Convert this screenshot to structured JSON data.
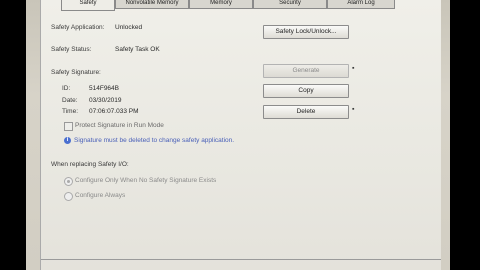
{
  "tabs": [
    "Safety",
    "Nonvolatile Memory",
    "Memory",
    "Security",
    "Alarm Log"
  ],
  "safety_application": {
    "label": "Safety Application:",
    "value": "Unlocked"
  },
  "safety_status": {
    "label": "Safety Status:",
    "value": "Safety Task OK"
  },
  "safety_signature": {
    "label": "Safety Signature:"
  },
  "signature": {
    "id_label": "ID:",
    "id_value": "514F964B",
    "date_label": "Date:",
    "date_value": "03/30/2019",
    "time_label": "Time:",
    "time_value": "07:06:07.033 PM"
  },
  "buttons": {
    "lock": "Safety Lock/Unlock...",
    "generate": "Generate",
    "copy": "Copy",
    "delete": "Delete"
  },
  "protect_checkbox": {
    "label": "Protect Signature in Run Mode",
    "checked": false
  },
  "info_message": "Signature must be deleted to change safety application.",
  "replacing": {
    "label": "When replacing Safety I/O:",
    "options": [
      "Configure Only When No Safety Signature Exists",
      "Configure Always"
    ]
  },
  "colors": {
    "info_text": "#4a60b8",
    "disabled_text": "#8a8a8a"
  }
}
